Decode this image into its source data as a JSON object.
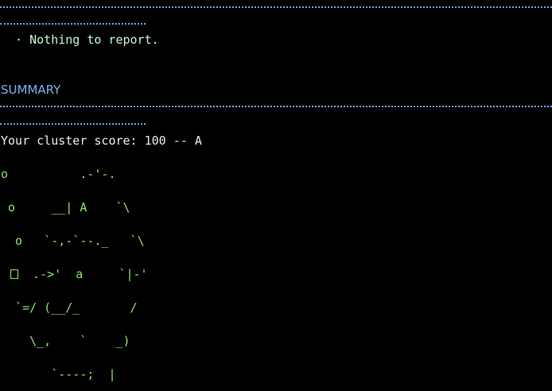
{
  "report": {
    "message": " · Nothing to report."
  },
  "summary": {
    "title": "SUMMARY",
    "score_text": "Your cluster score: 100 -- A"
  },
  "ascii_art": {
    "line1": "o          .-'-.",
    "line2": " o     __| A    `\\",
    "line3": "  o   `-,-`--._   `\\",
    "line4_after_box": "  .->'  a     `|-'",
    "line5": "  `=/ (__/_       /",
    "line6": "    \\_,    `    _)",
    "line7": "       `----;  |"
  },
  "colors": {
    "background": "#000000",
    "rule": "#6f9fd8",
    "section_title": "#7fb0ee",
    "message": "#c8f7d0",
    "art": "#8ee06d",
    "text": "#e9e9e9"
  }
}
